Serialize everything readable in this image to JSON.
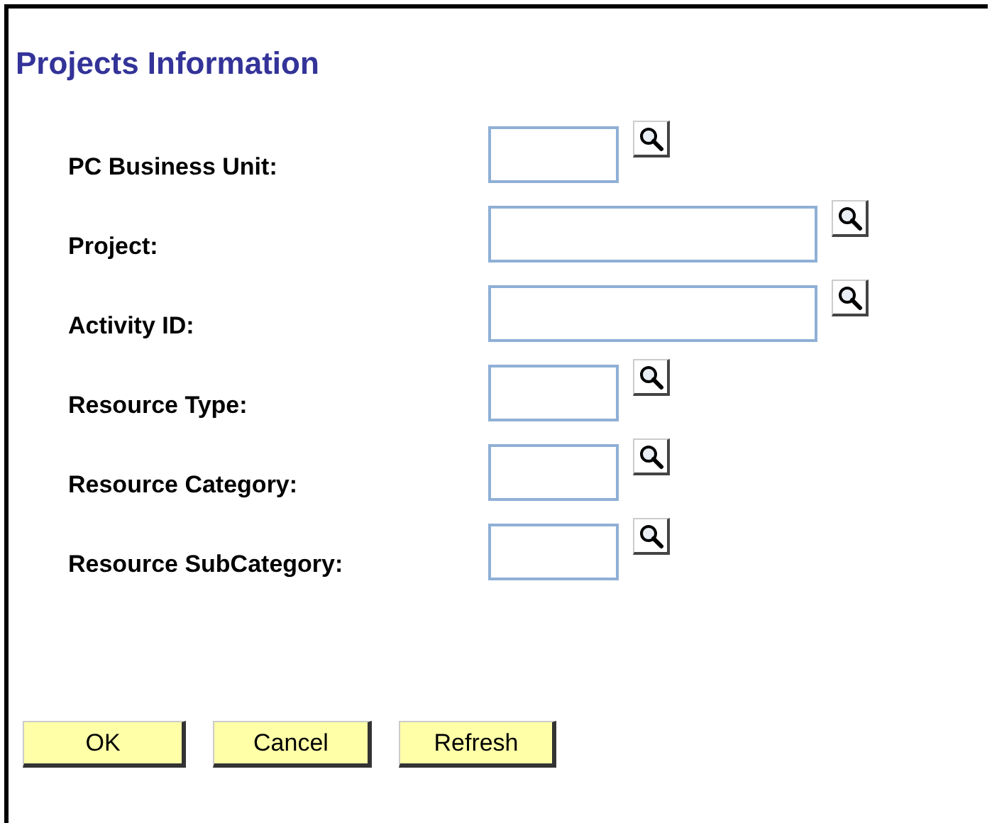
{
  "title": "Projects Information",
  "fields": [
    {
      "label": "PC Business Unit:",
      "kind": "short"
    },
    {
      "label": "Project:",
      "kind": "long"
    },
    {
      "label": "Activity ID:",
      "kind": "long"
    },
    {
      "label": "Resource Type:",
      "kind": "short"
    },
    {
      "label": "Resource Category:",
      "kind": "short"
    },
    {
      "label": "Resource SubCategory:",
      "kind": "short"
    }
  ],
  "buttons": [
    "OK",
    "Cancel",
    "Refresh"
  ]
}
